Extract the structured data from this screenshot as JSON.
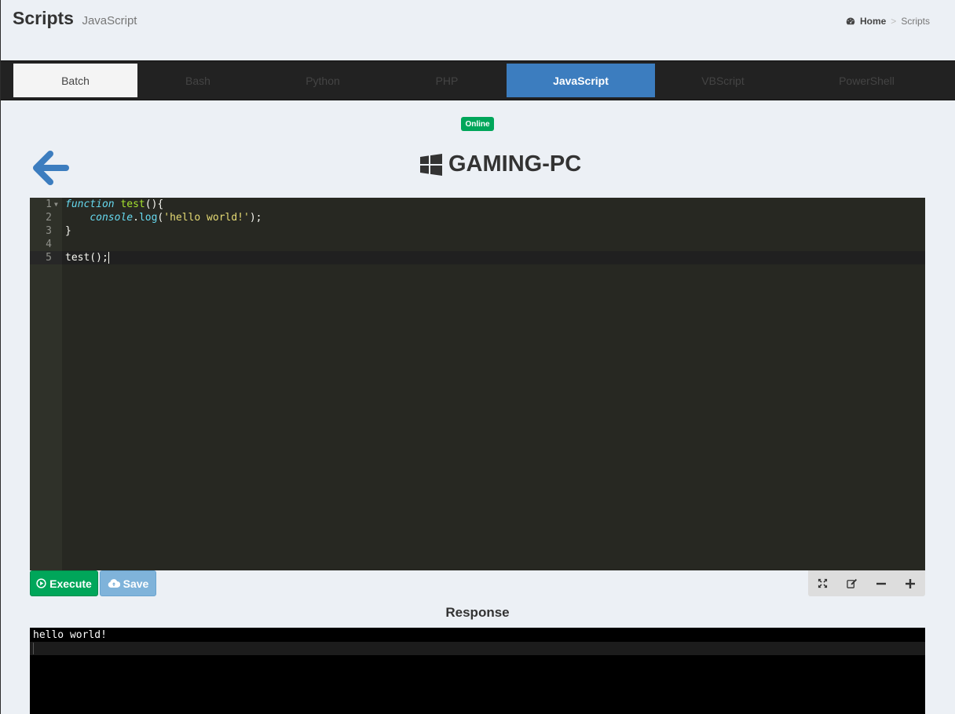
{
  "header": {
    "title": "Scripts",
    "subtitle": "JavaScript"
  },
  "breadcrumb": {
    "home": "Home",
    "separator": ">",
    "current": "Scripts"
  },
  "tabs": [
    {
      "label": "Batch",
      "state": "light"
    },
    {
      "label": "Bash",
      "state": "inactive"
    },
    {
      "label": "Python",
      "state": "inactive"
    },
    {
      "label": "PHP",
      "state": "inactive"
    },
    {
      "label": "JavaScript",
      "state": "active"
    },
    {
      "label": "VBScript",
      "state": "inactive"
    },
    {
      "label": "PowerShell",
      "state": "inactive"
    }
  ],
  "device": {
    "status": "Online",
    "name": "GAMING-PC",
    "os_icon": "windows-icon"
  },
  "editor": {
    "line_numbers": [
      "1",
      "2",
      "3",
      "4",
      "5"
    ],
    "lines": [
      "function test(){",
      "    console.log('hello world!');",
      "}",
      "",
      "test();"
    ]
  },
  "toolbar": {
    "execute_label": "Execute",
    "save_label": "Save"
  },
  "response": {
    "title": "Response",
    "output": "hello world!"
  },
  "colors": {
    "accent": "#3c7dbf",
    "success": "#00a65a",
    "editor_bg": "#272822"
  }
}
